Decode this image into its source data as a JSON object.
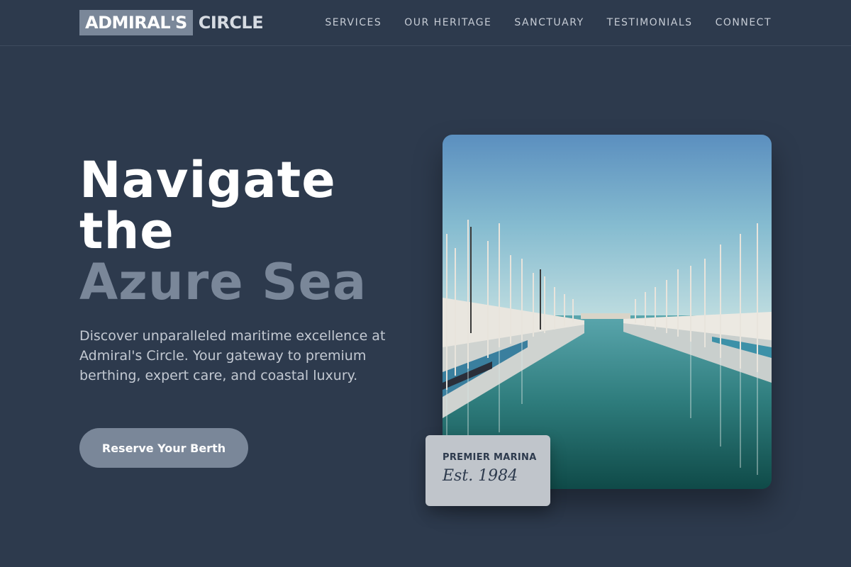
{
  "brand": {
    "logo_box_text": "ADMIRAL'S",
    "logo_rest_text": "CIRCLE"
  },
  "nav": {
    "items": [
      {
        "label": "SERVICES"
      },
      {
        "label": "OUR HERITAGE"
      },
      {
        "label": "SANCTUARY"
      },
      {
        "label": "TESTIMONIALS"
      },
      {
        "label": "CONNECT"
      }
    ]
  },
  "hero": {
    "title_line1": "Navigate",
    "title_line2": "the",
    "title_accent": "Azure Sea",
    "description": "Discover unparalleled maritime excellence at Admiral's Circle. Your gateway to premium berthing, expert care, and coastal luxury.",
    "cta_label": "Reserve Your Berth"
  },
  "badge": {
    "label": "PREMIER MARINA",
    "sub": "Est. 1984"
  },
  "colors": {
    "background": "#2d3a4d",
    "accent": "#7a8799",
    "badge_bg": "#c0c5cb",
    "text_light": "#c3c9d2"
  }
}
